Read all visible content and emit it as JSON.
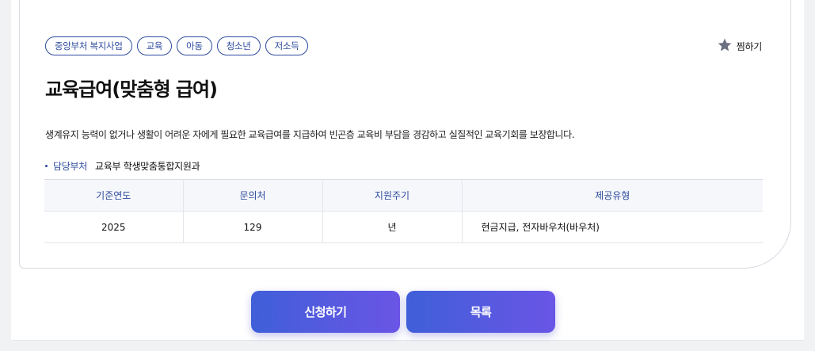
{
  "tags": [
    "중앙부처 복지사업",
    "교육",
    "아동",
    "청소년",
    "저소득"
  ],
  "favorite": {
    "label": "찜하기",
    "icon": "star-icon",
    "color": "#6b7083"
  },
  "title": "교육급여(맞춤형 급여)",
  "description": "생계유지 능력이 없거나 생활이 어려운 자에게 필요한 교육급여를 지급하여 빈곤층 교육비 부담을 경감하고 실질적인 교육기회를 보장합니다.",
  "department": {
    "label": "담당부처",
    "value": "교육부 학생맞춤통합지원과"
  },
  "table": {
    "headers": [
      "기준연도",
      "문의처",
      "지원주기",
      "제공유형"
    ],
    "rows": [
      [
        "2025",
        "129",
        "년",
        "현금지급, 전자바우처(바우처)"
      ]
    ]
  },
  "buttons": {
    "apply": "신청하기",
    "list": "목록"
  },
  "colors": {
    "accent": "#2d4a9e",
    "button_start": "#3f5fd8",
    "button_end": "#6a55e6"
  }
}
